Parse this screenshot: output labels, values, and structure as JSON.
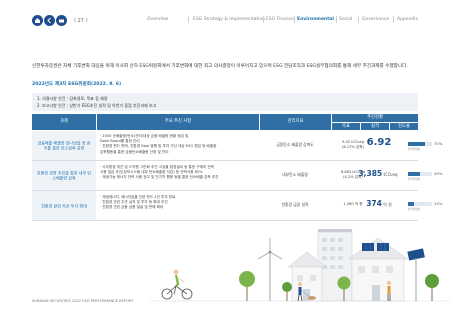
{
  "header": {
    "page_number": "27",
    "nav": [
      {
        "label": "Overview",
        "active": false
      },
      {
        "label": "ESG Strategy & Implementation",
        "active": false
      },
      {
        "label": "ESG Finance",
        "active": false
      },
      {
        "label": "Environmental",
        "active": true
      },
      {
        "label": "Social",
        "active": false
      },
      {
        "label": "Governance",
        "active": false
      },
      {
        "label": "Appendix",
        "active": false
      }
    ]
  },
  "intro": "신한투자증권은 자체 기후변화 대응을 위해 이사회 산하 ESG위원회에서 기후변화에 대한 최고 의사결정이 이루어지고 있으며 ESG 전담조직과 ESG실무협의회를 통해 세부 추진과제를 수행합니다.",
  "section_title": "2022년도 제3차 ESG위원회(2022. 9. 6)",
  "agenda": {
    "line1": "1. 의결사항 안건 : 감축경로, 목표 등 제정",
    "line2": "2. 보고사항 안건 : 상반기 ESG추진 실적 및 하반기 중점 추진과제 보고"
  },
  "table": {
    "headers": {
      "task": "과제",
      "plan": "주요 추진 사항",
      "metric": "관리지표",
      "progress": "추진현황",
      "target": "목표",
      "actual": "실적",
      "achievement": "진도율"
    },
    "progress_label": "실적달성률",
    "rows": [
      {
        "task": "금융배출 배출량 감나반질 정 관리를 통한 탄소감축 강화",
        "plan": [
          "· 2050 순배출량(탄소)관리/대상 금융 배출량 현황 점검 및",
          "  Dash Board를 통한 관리",
          "· 친환경 펀드 판매, 친환경 Deal 발행 및 투자 가산 대상 ESG 편입 등 배출량",
          "  감축활동을 통한 금융탄소배출량 산정 및 관리"
        ],
        "metric": "금융탄소 배출량 감축도",
        "target": [
          "9.02 tCO₂eq",
          "(6.17% 감축)"
        ],
        "actual_value": "6.92",
        "actual_unit": "",
        "achievement": "70%",
        "achievement_fraction": 0.7
      },
      {
        "task": "친환경 경영 추진을 통한 내부 탄소배출량 감축",
        "plan": [
          "· 사무환경 개선 및 IT자원 그린화 추진 고효율 환경설비 등 통한 구매의 전력",
          "  사용 절감 추진(정보시스템 내부 탄소배출량 저감) 등 전력사용 85%",
          "· 재생가능 에너지 전력 사용 권고 및 전기차 활용 등을 통한 탄소배출 감축 추진"
        ],
        "metric": "내부탄소 배출량",
        "target": [
          "6,683 tCO₂eq",
          "(4.2% 감축)"
        ],
        "actual_value": "3,385",
        "actual_unit": "tCO₂eq",
        "achievement": "49%",
        "achievement_fraction": 0.49
      },
      {
        "task": "친환경 관련 자산 투자 확대",
        "plan": [
          "· 재생에너지, 에너지효율 관련 펀드 2건 투자 완료",
          "· 친환경 관련 주관 실적 및 투자 등 확대 추진",
          "· 친환경 관련 금융 상품 발굴 및 판매 확대"
        ],
        "metric": "친환경 금융 실적",
        "target": [
          "1,560 억 원"
        ],
        "actual_value": "374",
        "actual_unit": "억 원",
        "achievement": "24%",
        "achievement_fraction": 0.24
      }
    ]
  },
  "footer": "SHINHAN SECURITIES  2022 ESG PERFORMANCE REPORT",
  "colors": {
    "brand_blue": "#1f4e8c",
    "accent_blue": "#1b6fb0",
    "header_blue": "#2f6fa6",
    "tree_green": "#7bb54c"
  }
}
